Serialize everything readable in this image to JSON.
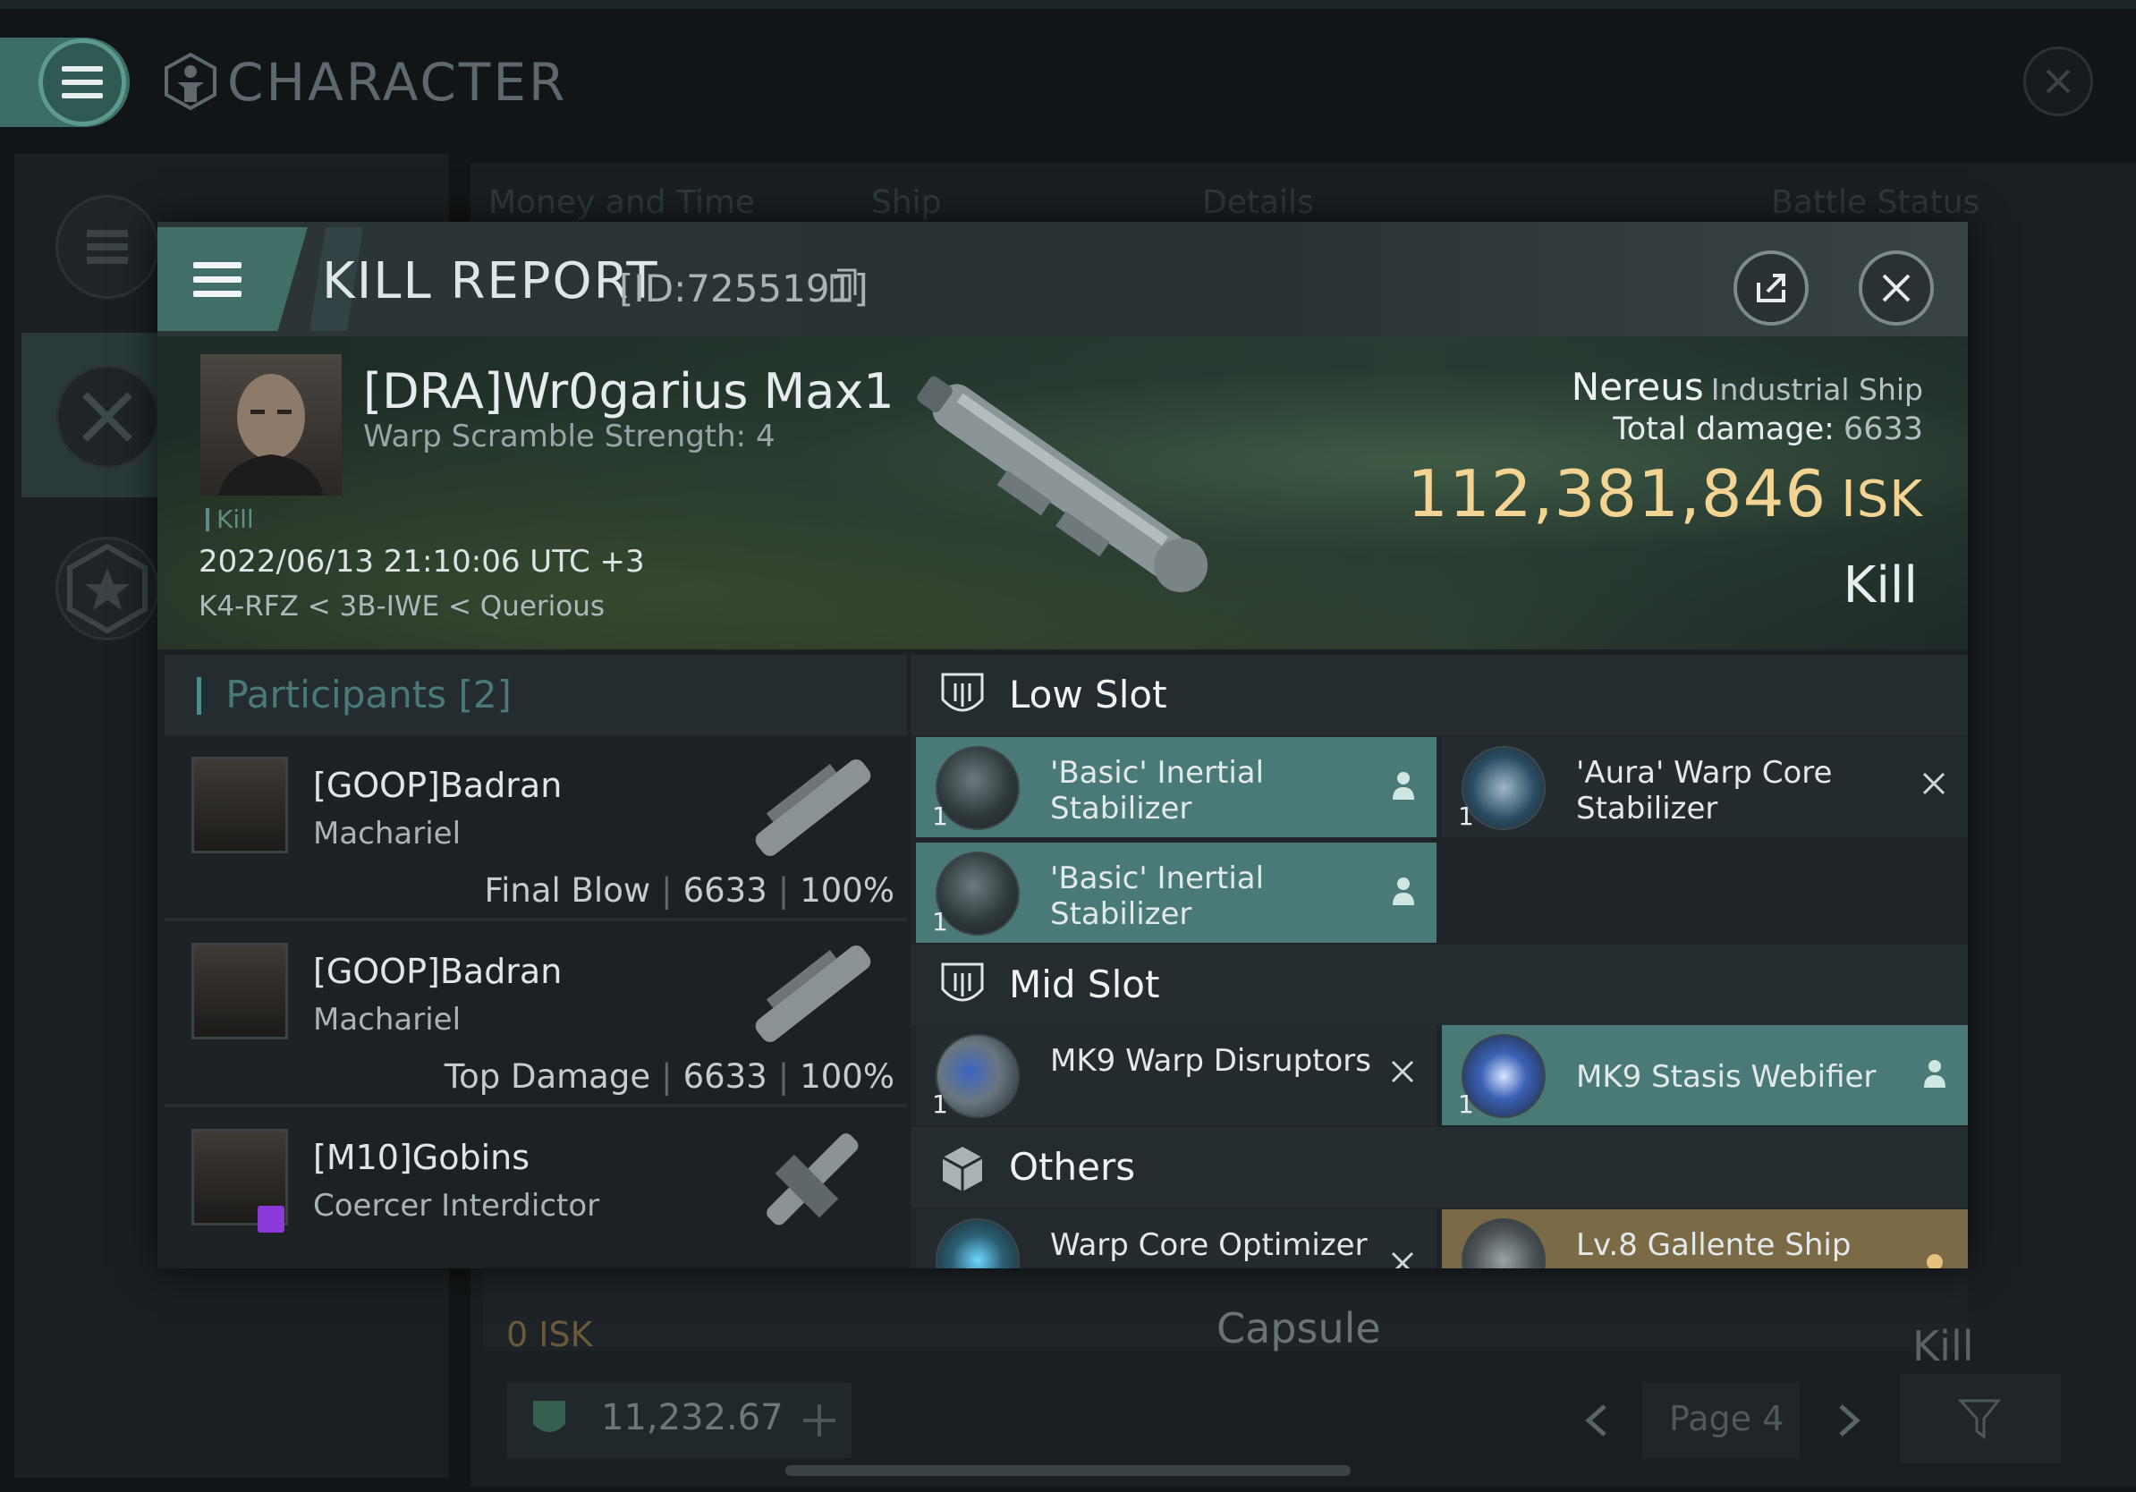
{
  "background_window": {
    "title": "CHARACTER",
    "columns": [
      "Money and Time",
      "Ship",
      "Details",
      "Battle Status"
    ],
    "row_isk": "0  ISK",
    "row_ship": "Capsule",
    "row_result": "Kill",
    "wallet_value": "11,232.67",
    "page_label": "Page 4"
  },
  "kill_report": {
    "title": "KILL REPORT",
    "id_text": "[ID:7255191]",
    "victim": {
      "name": "[DRA]Wr0garius Max1",
      "warp_scramble": "Warp Scramble Strength: 4",
      "tag": "Kill",
      "datetime": "2022/06/13 21:10:06 UTC +3",
      "location": "K4-RFZ < 3B-IWE < Querious"
    },
    "ship": {
      "name": "Nereus",
      "class": "Industrial Ship",
      "total_damage_label": "Total damage:",
      "total_damage_value": "6633",
      "isk_value": "112,381,846",
      "isk_unit": "ISK",
      "result": "Kill"
    },
    "participants": {
      "title": "Participants",
      "count": "[2]",
      "rows": [
        {
          "name": "[GOOP]Badran",
          "ship": "Machariel",
          "role": "Final Blow",
          "damage": "6633",
          "percent": "100%"
        },
        {
          "name": "[GOOP]Badran",
          "ship": "Machariel",
          "role": "Top Damage",
          "damage": "6633",
          "percent": "100%"
        },
        {
          "name": "[M10]Gobins",
          "ship": "Coercer Interdictor",
          "role": "",
          "damage": "",
          "percent": ""
        }
      ]
    },
    "slots": {
      "low": {
        "title": "Low Slot",
        "modules": [
          {
            "name": "'Basic' Inertial Stabilizer",
            "qty": "1",
            "status": "dropped"
          },
          {
            "name": "'Aura' Warp Core Stabilizer",
            "qty": "1",
            "status": "destroyed"
          },
          {
            "name": "'Basic' Inertial Stabilizer",
            "qty": "1",
            "status": "dropped"
          }
        ]
      },
      "mid": {
        "title": "Mid Slot",
        "modules": [
          {
            "name": "MK9 Warp Disruptors",
            "qty": "1",
            "status": "destroyed"
          },
          {
            "name": "MK9 Stasis Webifier",
            "qty": "1",
            "status": "dropped"
          }
        ]
      },
      "others": {
        "title": "Others",
        "modules": [
          {
            "name": "Warp Core Optimizer",
            "qty": "",
            "status": "destroyed"
          },
          {
            "name": "Lv.8 Gallente Ship",
            "qty": "",
            "status": "dropped"
          }
        ]
      }
    }
  },
  "colors": {
    "accent_teal": "#4a7a75",
    "isk_gold": "#f4d492",
    "drone_bronze": "#7a6a45"
  }
}
